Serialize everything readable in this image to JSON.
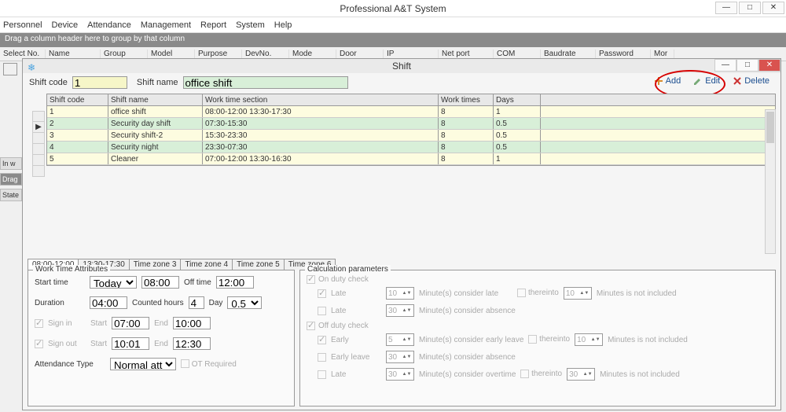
{
  "app_title": "Professional A&T System",
  "menus": [
    "Personnel",
    "Device",
    "Attendance",
    "Management",
    "Report",
    "System",
    "Help"
  ],
  "group_hint": "Drag a column header here to group by that column",
  "main_cols": [
    "Select No.",
    "Name",
    "Group",
    "Model",
    "Purpose",
    "DevNo.",
    "Mode",
    "Door",
    "IP",
    "Net port",
    "COM",
    "Baudrate",
    "Password",
    "Mor"
  ],
  "left_labels": [
    "In w",
    "Drag",
    "State"
  ],
  "sub_title": "Shift",
  "shift_code_label": "Shift code",
  "shift_code_value": "1",
  "shift_name_label": "Shift name",
  "shift_name_value": "office shift",
  "btn_add": "Add",
  "btn_edit": "Edit",
  "btn_delete": "Delete",
  "grid_head": {
    "code": "Shift code",
    "name": "Shift name",
    "sect": "Work time section",
    "times": "Work times",
    "days": "Days"
  },
  "rows": [
    {
      "code": "1",
      "name": "office shift",
      "sect": "08:00-12:00 13:30-17:30",
      "times": "8",
      "days": "1"
    },
    {
      "code": "2",
      "name": "Security day shift",
      "sect": "07:30-15:30",
      "times": "8",
      "days": "0.5"
    },
    {
      "code": "3",
      "name": "Security shift-2",
      "sect": "15:30-23:30",
      "times": "8",
      "days": "0.5"
    },
    {
      "code": "4",
      "name": "Security night",
      "sect": "23:30-07:30",
      "times": "8",
      "days": "0.5"
    },
    {
      "code": "5",
      "name": "Cleaner",
      "sect": "07:00-12:00 13:30-16:30",
      "times": "8",
      "days": "1"
    }
  ],
  "tabs": [
    "08:00-12:00",
    "13:30-17:30",
    "Time zone 3",
    "Time zone 4",
    "Time zone 5",
    "Time zone 6"
  ],
  "wta_legend": "Work Time Attributes",
  "calc_legend": "Calculation parameters",
  "wta": {
    "start_time_lbl": "Start time",
    "today": "Today",
    "start_time": "08:00",
    "off_time_lbl": "Off time",
    "off_time": "12:00",
    "duration_lbl": "Duration",
    "duration": "04:00",
    "counted_lbl": "Counted hours",
    "counted": "4",
    "day_lbl": "Day",
    "day": "0.5",
    "sign_in_lbl": "Sign in",
    "sign_in_start": "07:00",
    "sign_in_end": "10:00",
    "start_lbl": "Start",
    "end_lbl": "End",
    "sign_out_lbl": "Sign out",
    "sign_out_start": "10:01",
    "sign_out_end": "12:30",
    "att_type_lbl": "Attendance Type",
    "att_type": "Normal atten",
    "ot_req": "OT Required"
  },
  "calc": {
    "on_duty": "On duty check",
    "off_duty": "Off duty check",
    "late": "Late",
    "early": "Early",
    "early_leave": "Early leave",
    "v10": "10",
    "v30": "30",
    "v5": "5",
    "min_late": "Minute(s) consider late",
    "min_absence": "Minute(s) consider absence",
    "min_early": "Minute(s) consider early leave",
    "min_overtime": "Minute(s) consider overtime",
    "thereinto": "thereinto",
    "not_incl": "Minutes is not included"
  }
}
